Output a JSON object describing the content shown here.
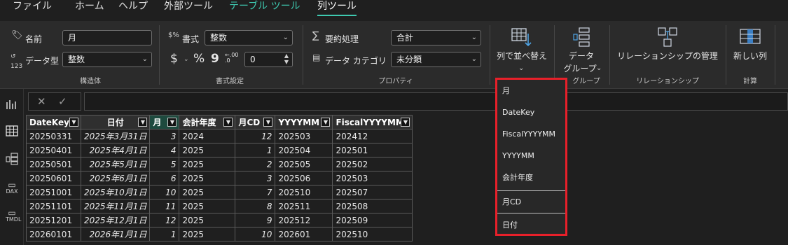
{
  "menu": {
    "items": [
      "ファイル",
      "ホーム",
      "ヘルプ",
      "外部ツール",
      "テーブル ツール",
      "列ツール"
    ]
  },
  "ribbon": {
    "structure": {
      "name_label": "名前",
      "name_value": "月",
      "datatype_label": "データ型",
      "datatype_value": "整数",
      "group_label": "構造体"
    },
    "format": {
      "format_label": "書式",
      "format_value": "整数",
      "currency_symbol": "$",
      "percent_symbol": "%",
      "comma_symbol": "9",
      "decimal_symbol": "←.00 .0",
      "decimal_value": "0",
      "group_label": "書式設定"
    },
    "properties": {
      "summarize_label": "要約処理",
      "summarize_value": "合計",
      "category_label": "データ カテゴリ",
      "category_value": "未分類",
      "group_label": "プロパティ"
    },
    "sort": {
      "label": "列で並べ替え"
    },
    "data_groups": {
      "label_line1": "データ",
      "label_line2": "グループ",
      "group_label": "グループ"
    },
    "relationships": {
      "label": "リレーションシップの管理",
      "group_label": "リレーションシップ"
    },
    "calculations": {
      "label": "新しい列",
      "group_label": "計算"
    }
  },
  "formula_bar": {
    "cancel_icon": "✕",
    "commit_icon": "✓",
    "value": ""
  },
  "rail": {
    "dax_label": "DAX",
    "tmdl_label": "TMDL"
  },
  "table": {
    "columns": [
      "DateKey",
      "日付",
      "月",
      "会計年度",
      "月CD",
      "YYYYMM",
      "FiscalYYYYMM"
    ],
    "rows": [
      [
        "20250331",
        "2025年3月31日",
        "3",
        "2024",
        "12",
        "202503",
        "202412"
      ],
      [
        "20250401",
        "2025年4月1日",
        "4",
        "2025",
        "1",
        "202504",
        "202501"
      ],
      [
        "20250501",
        "2025年5月1日",
        "5",
        "2025",
        "2",
        "202505",
        "202502"
      ],
      [
        "20250601",
        "2025年6月1日",
        "6",
        "2025",
        "3",
        "202506",
        "202503"
      ],
      [
        "20251001",
        "2025年10月1日",
        "10",
        "2025",
        "7",
        "202510",
        "202507"
      ],
      [
        "20251101",
        "2025年11月1日",
        "11",
        "2025",
        "8",
        "202511",
        "202508"
      ],
      [
        "20251201",
        "2025年12月1日",
        "12",
        "2025",
        "9",
        "202512",
        "202509"
      ],
      [
        "20260101",
        "2026年1月1日",
        "1",
        "2025",
        "10",
        "202601",
        "202510"
      ]
    ]
  },
  "sort_dropdown": {
    "options": [
      "月",
      "DateKey",
      "FiscalYYYYMM",
      "YYYYMM",
      "会計年度",
      "月CD",
      "日付"
    ]
  },
  "colors": {
    "accent": "#3ec9b0",
    "highlight_border": "#e8202a",
    "selected_header": "#1d4a3e"
  }
}
